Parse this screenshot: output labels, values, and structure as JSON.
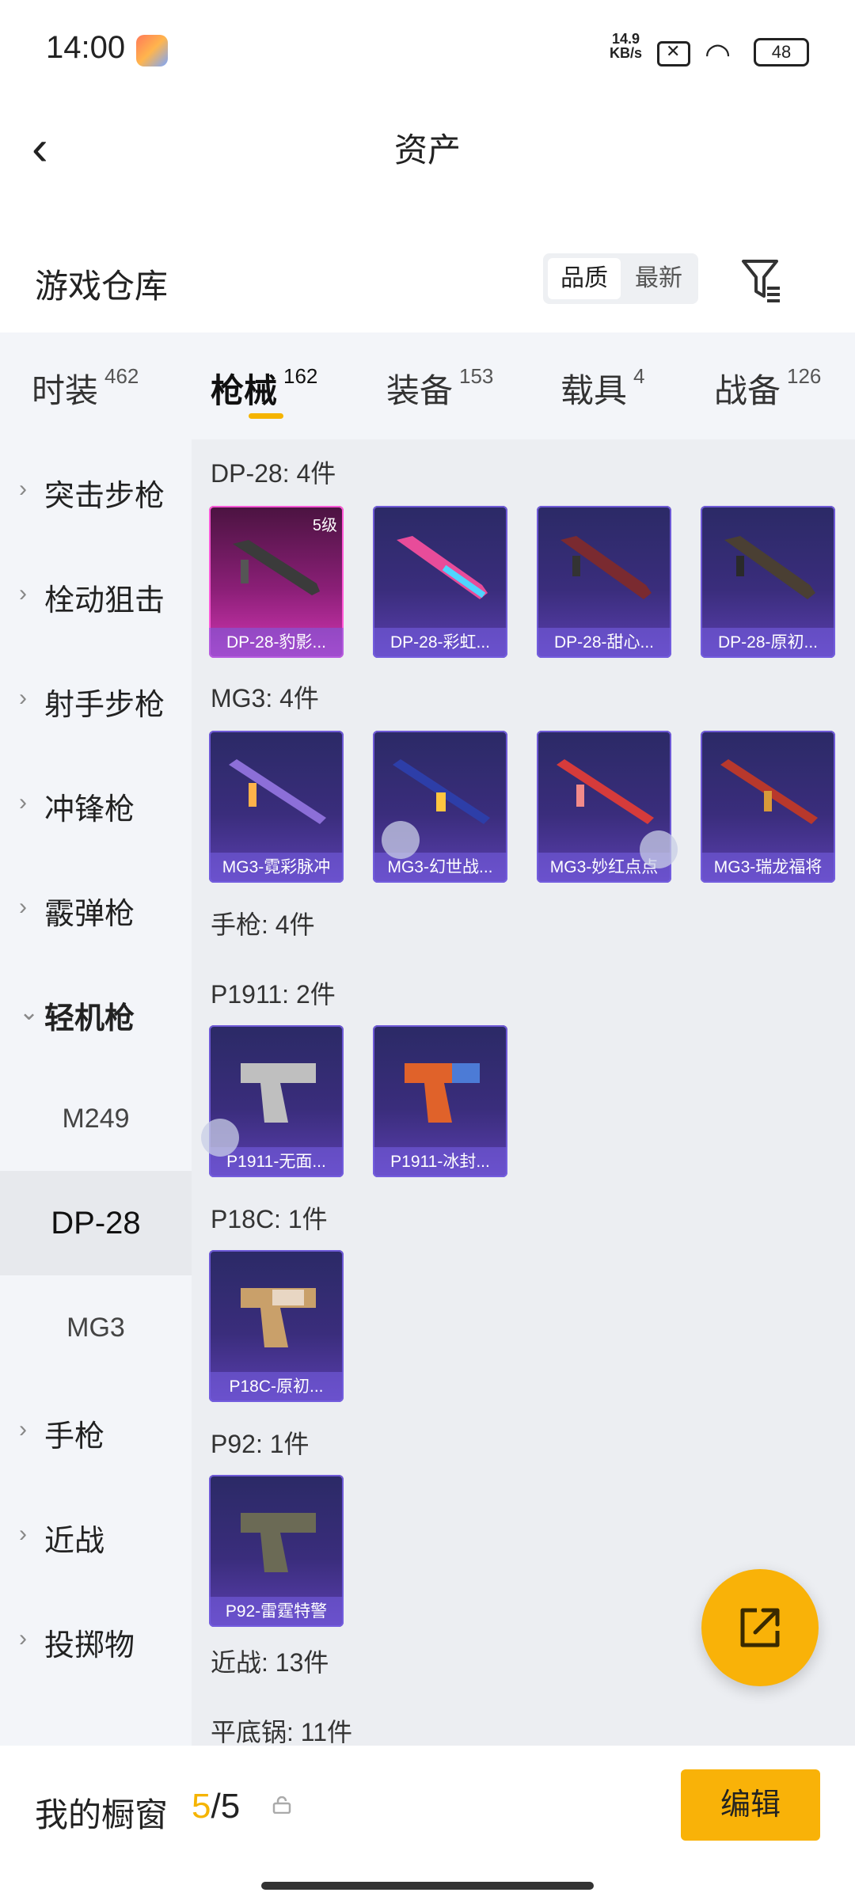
{
  "status": {
    "time": "14:00",
    "net_speed": "14.9",
    "net_unit": "KB/s",
    "battery": "48"
  },
  "header": {
    "title": "资产"
  },
  "warehouse": {
    "label": "游戏仓库",
    "sort_options": [
      "品质",
      "最新"
    ],
    "active_sort": "品质"
  },
  "tabs": [
    {
      "label": "时装",
      "count": "462"
    },
    {
      "label": "枪械",
      "count": "162"
    },
    {
      "label": "装备",
      "count": "153"
    },
    {
      "label": "载具",
      "count": "4"
    },
    {
      "label": "战备",
      "count": "126"
    }
  ],
  "active_tab": "枪械",
  "sidebar": {
    "items": [
      {
        "label": "突击步枪"
      },
      {
        "label": "栓动狙击"
      },
      {
        "label": "射手步枪"
      },
      {
        "label": "冲锋枪"
      },
      {
        "label": "霰弹枪"
      },
      {
        "label": "轻机枪"
      },
      {
        "label": "手枪"
      },
      {
        "label": "近战"
      },
      {
        "label": "投掷物"
      }
    ],
    "sub_items": [
      "M249",
      "DP-28",
      "MG3"
    ],
    "selected_sub": "DP-28"
  },
  "sections": [
    {
      "title": "DP-28: 4件",
      "cards": [
        {
          "name": "DP-28-豹影...",
          "level": "5级",
          "quality": "gold"
        },
        {
          "name": "DP-28-彩虹..."
        },
        {
          "name": "DP-28-甜心..."
        },
        {
          "name": "DP-28-原初..."
        }
      ]
    },
    {
      "title": "MG3: 4件",
      "cards": [
        {
          "name": "MG3-霓彩脉冲"
        },
        {
          "name": "MG3-幻世战..."
        },
        {
          "name": "MG3-妙红点点"
        },
        {
          "name": "MG3-瑞龙福将"
        }
      ]
    },
    {
      "title": "手枪: 4件"
    },
    {
      "title": "P1911: 2件",
      "cards": [
        {
          "name": "P1911-无面..."
        },
        {
          "name": "P1911-冰封..."
        }
      ]
    },
    {
      "title": "P18C: 1件",
      "cards": [
        {
          "name": "P18C-原初..."
        }
      ]
    },
    {
      "title": "P92: 1件",
      "cards": [
        {
          "name": "P92-雷霆特警"
        }
      ]
    },
    {
      "title": "近战: 13件"
    },
    {
      "title": "平底锅: 11件"
    }
  ],
  "bottom": {
    "label": "我的橱窗",
    "current": "5",
    "total": "/5",
    "edit_label": "编辑"
  },
  "colors": {
    "accent": "#f9b208",
    "card_purple": "#3a2d7c",
    "card_gold": "#d436b4"
  }
}
